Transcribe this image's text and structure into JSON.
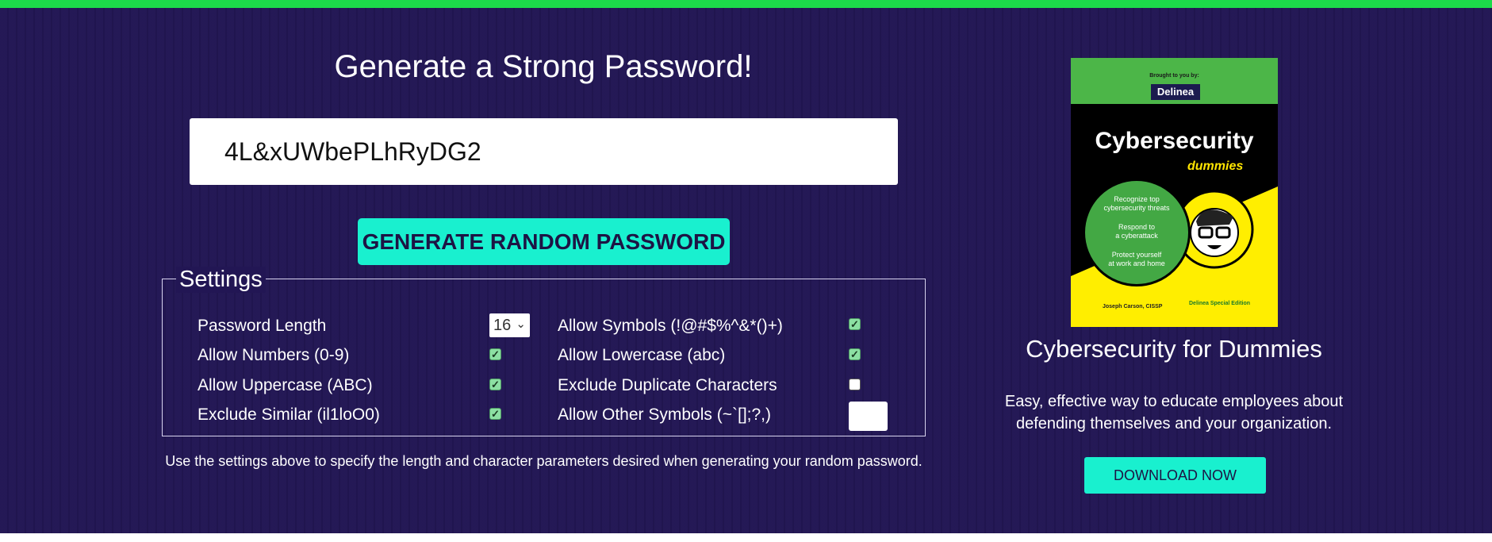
{
  "generator": {
    "title": "Generate a Strong Password!",
    "password_value": "4L&xUWbePLhRyDG2",
    "generate_button": "GENERATE RANDOM PASSWORD"
  },
  "settings": {
    "legend": "Settings",
    "password_length": {
      "label": "Password Length",
      "value": "16"
    },
    "allow_numbers": {
      "label": "Allow Numbers (0-9)",
      "checked": true
    },
    "allow_uppercase": {
      "label": "Allow Uppercase (ABC)",
      "checked": true
    },
    "exclude_similar": {
      "label": "Exclude Similar (il1loO0)",
      "checked": true
    },
    "allow_symbols": {
      "label": "Allow Symbols (!@#$%^&*()+)",
      "checked": true
    },
    "allow_lowercase": {
      "label": "Allow Lowercase (abc)",
      "checked": true
    },
    "exclude_duplicates": {
      "label": "Exclude Duplicate Characters",
      "checked": false
    },
    "allow_other_symbols": {
      "label": "Allow Other Symbols (~`[];?,)",
      "value": ""
    },
    "note": "Use the settings above to specify the length and character parameters desired when generating your random password."
  },
  "promo": {
    "book_cover": {
      "brought_by": "Brought to you by:",
      "brand": "Delinea",
      "title": "Cybersecurity",
      "series": "dummies",
      "bullets": [
        "Recognize top",
        "cybersecurity threats",
        "Respond to",
        "a cyberattack",
        "Protect yourself",
        "at work and home"
      ],
      "author": "Joseph Carson, CISSP",
      "edition": "Delinea Special Edition"
    },
    "title": "Cybersecurity for Dummies",
    "description": "Easy, effective way to educate employees about defending themselves and your organization.",
    "download_button": "DOWNLOAD NOW"
  },
  "colors": {
    "background": "#221654",
    "accent": "#19f0cf",
    "top_bar": "#1cdb4a"
  }
}
